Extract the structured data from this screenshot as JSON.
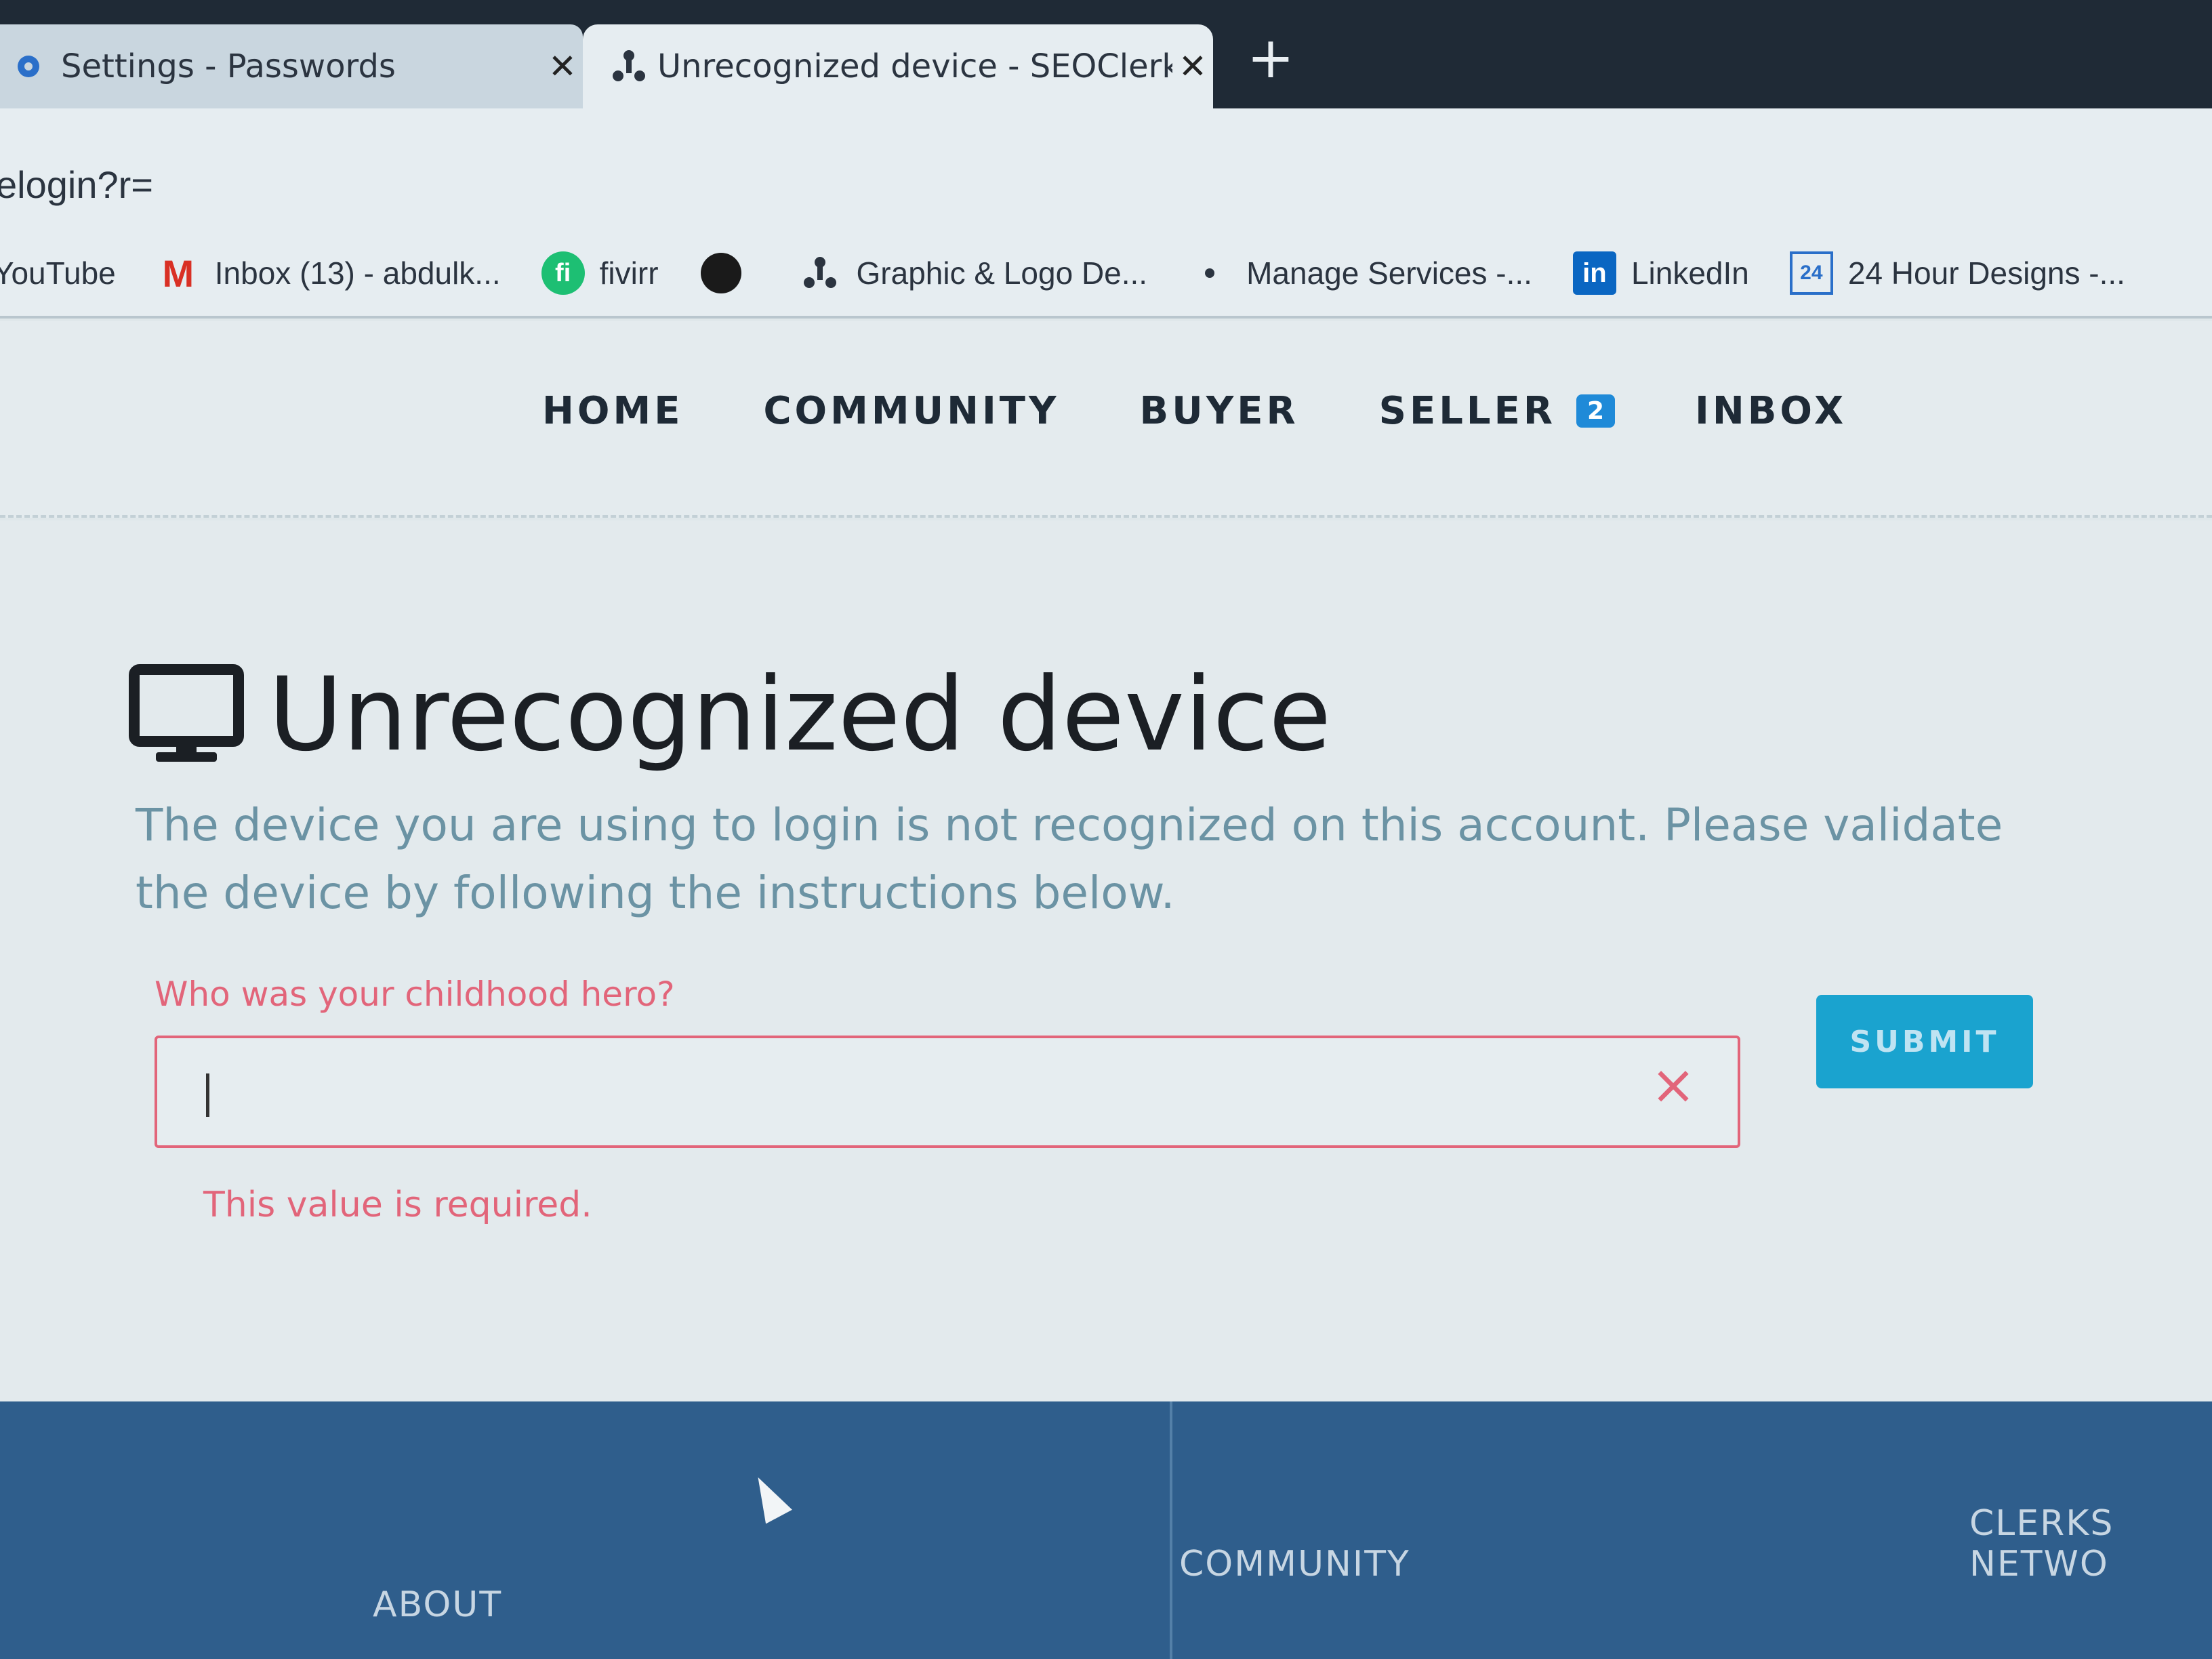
{
  "browser": {
    "tabs": [
      {
        "title": "Settings - Passwords",
        "active": false
      },
      {
        "title": "Unrecognized device - SEOClerks",
        "active": true
      }
    ],
    "new_tab_symbol": "+",
    "close_symbol": "✕",
    "url": "elogin?r=",
    "bookmarks": [
      {
        "label": "YouTube",
        "icon": "youtube-icon"
      },
      {
        "label": "Inbox (13) - abdulk...",
        "icon": "gmail-icon"
      },
      {
        "label": "fivirr",
        "icon": "fiverr-icon"
      },
      {
        "label": "",
        "icon": "globe-icon"
      },
      {
        "label": "Graphic & Logo De...",
        "icon": "seoclerks-icon"
      },
      {
        "label": "Manage Services -...",
        "icon": "dot-icon"
      },
      {
        "label": "LinkedIn",
        "icon": "linkedin-icon"
      },
      {
        "label": "24 Hour Designs -...",
        "icon": "24-icon"
      }
    ]
  },
  "nav": {
    "home": "HOME",
    "community": "COMMUNITY",
    "buyer": "BUYER",
    "seller": "SELLER",
    "seller_badge": "2",
    "inbox": "INBOX"
  },
  "main": {
    "title": "Unrecognized device",
    "subtitle": "The device you are using to login is not recognized on this account. Please validate the device by following the instructions below.",
    "question_label": "Who was your childhood hero?",
    "answer_value": "",
    "error_text": "This value is required.",
    "submit_label": "SUBMIT"
  },
  "footer": {
    "about": "ABOUT",
    "community": "COMMUNITY",
    "network": "CLERKS NETWO"
  },
  "colors": {
    "accent": "#1aa3cf",
    "error": "#e2657a",
    "badge": "#1f8ad8",
    "footer_bg": "#2f5e8c"
  }
}
